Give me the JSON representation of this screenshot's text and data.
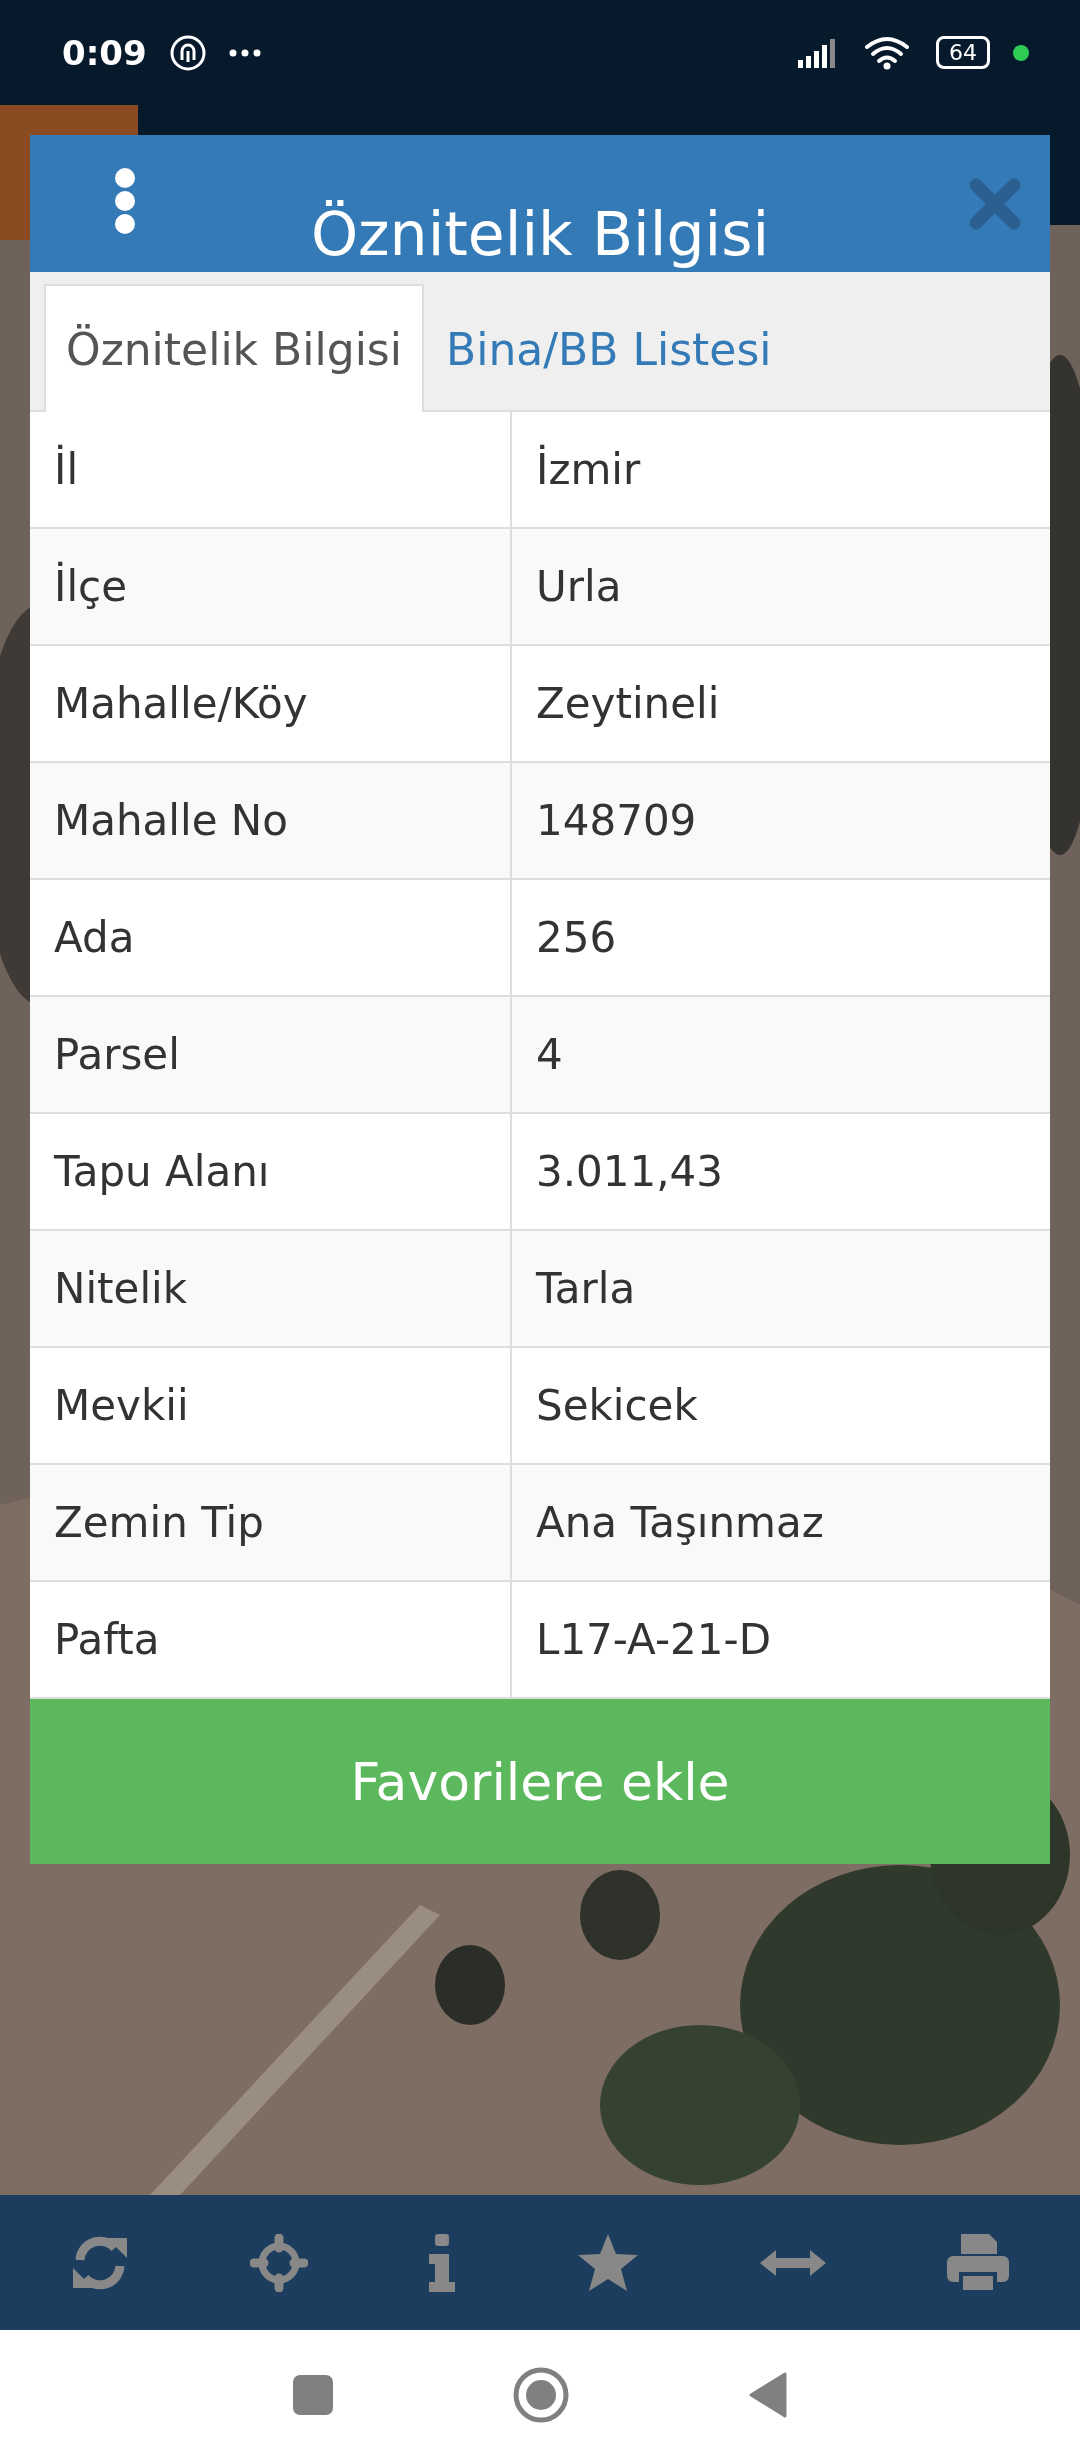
{
  "status_bar": {
    "time": "0:09",
    "battery": "64"
  },
  "dialog": {
    "title": "Öznitelik Bilgisi",
    "tabs": [
      {
        "label": "Öznitelik Bilgisi",
        "selected": true
      },
      {
        "label": "Bina/BB Listesi",
        "selected": false
      }
    ],
    "rows": [
      {
        "label": "İl",
        "value": "İzmir"
      },
      {
        "label": "İlçe",
        "value": "Urla"
      },
      {
        "label": "Mahalle/Köy",
        "value": "Zeytineli"
      },
      {
        "label": "Mahalle No",
        "value": "148709"
      },
      {
        "label": "Ada",
        "value": "256"
      },
      {
        "label": "Parsel",
        "value": "4"
      },
      {
        "label": "Tapu Alanı",
        "value": "3.011,43"
      },
      {
        "label": "Nitelik",
        "value": "Tarla"
      },
      {
        "label": "Mevkii",
        "value": "Sekicek"
      },
      {
        "label": "Zemin Tip",
        "value": "Ana Taşınmaz"
      },
      {
        "label": "Pafta",
        "value": "L17-A-21-D"
      }
    ],
    "button": "Favorilere ekle"
  },
  "toolbar": [
    {
      "kind": "refresh"
    },
    {
      "kind": "locate"
    },
    {
      "kind": "info"
    },
    {
      "kind": "star"
    },
    {
      "kind": "measure"
    },
    {
      "kind": "print"
    }
  ]
}
